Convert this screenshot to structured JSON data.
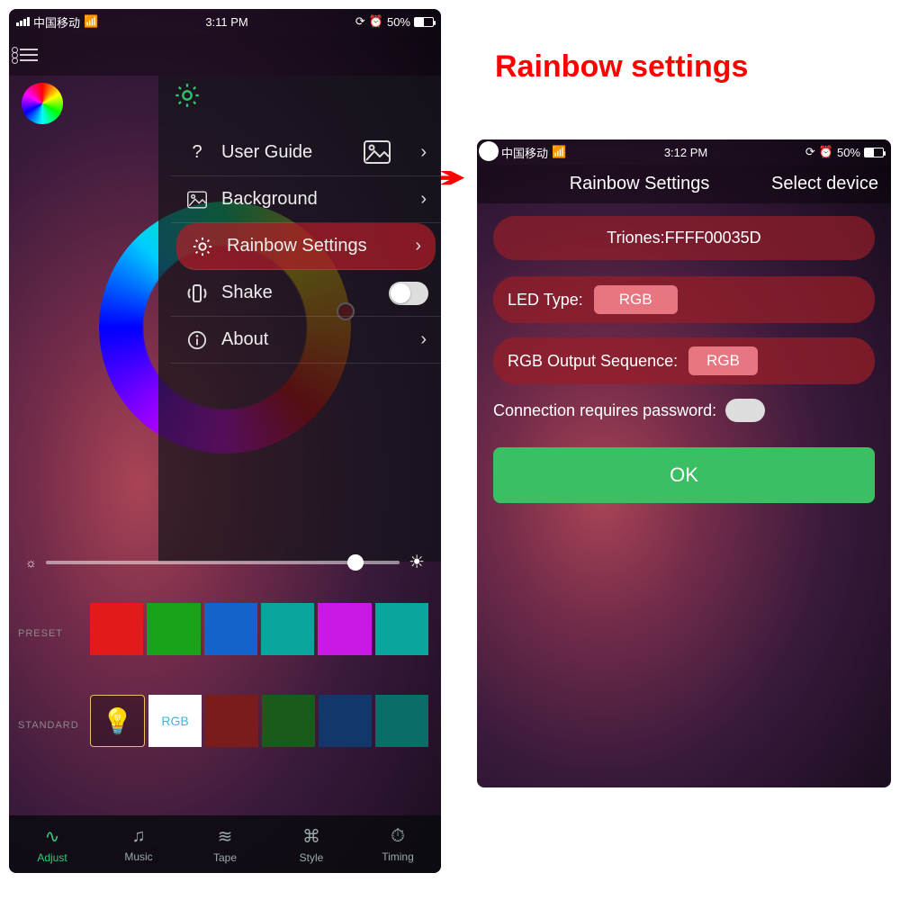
{
  "annotation": {
    "title": "Rainbow settings"
  },
  "status": {
    "carrier": "中国移动",
    "time_left": "3:11 PM",
    "time_right": "3:12 PM",
    "battery_pct": "50%"
  },
  "left": {
    "menu": {
      "user_guide": "User Guide",
      "background": "Background",
      "rainbow": "Rainbow Settings",
      "shake": "Shake",
      "about": "About"
    },
    "rows": {
      "preset": "PRESET",
      "standard": "STANDARD",
      "rgb_swatch": "RGB"
    },
    "preset_colors": [
      "#e41a1a",
      "#17a21a",
      "#1463c9",
      "#0aa59c",
      "#c91ae4",
      "#0aa59c"
    ],
    "standard_colors": [
      "bulb",
      "rgb",
      "#7a1c1c",
      "#1a5a1a",
      "#12386b",
      "#0b6d67"
    ],
    "tabs": {
      "adjust": "Adjust",
      "music": "Music",
      "tape": "Tape",
      "style": "Style",
      "timing": "Timing"
    }
  },
  "right": {
    "header": {
      "title": "Rainbow Settings",
      "action": "Select device"
    },
    "device": "Triones:FFFF00035D",
    "led_type_label": "LED Type:",
    "led_type_value": "RGB",
    "seq_label": "RGB Output Sequence:",
    "seq_value": "RGB",
    "conn_pwd": "Connection requires password:",
    "ok": "OK"
  }
}
